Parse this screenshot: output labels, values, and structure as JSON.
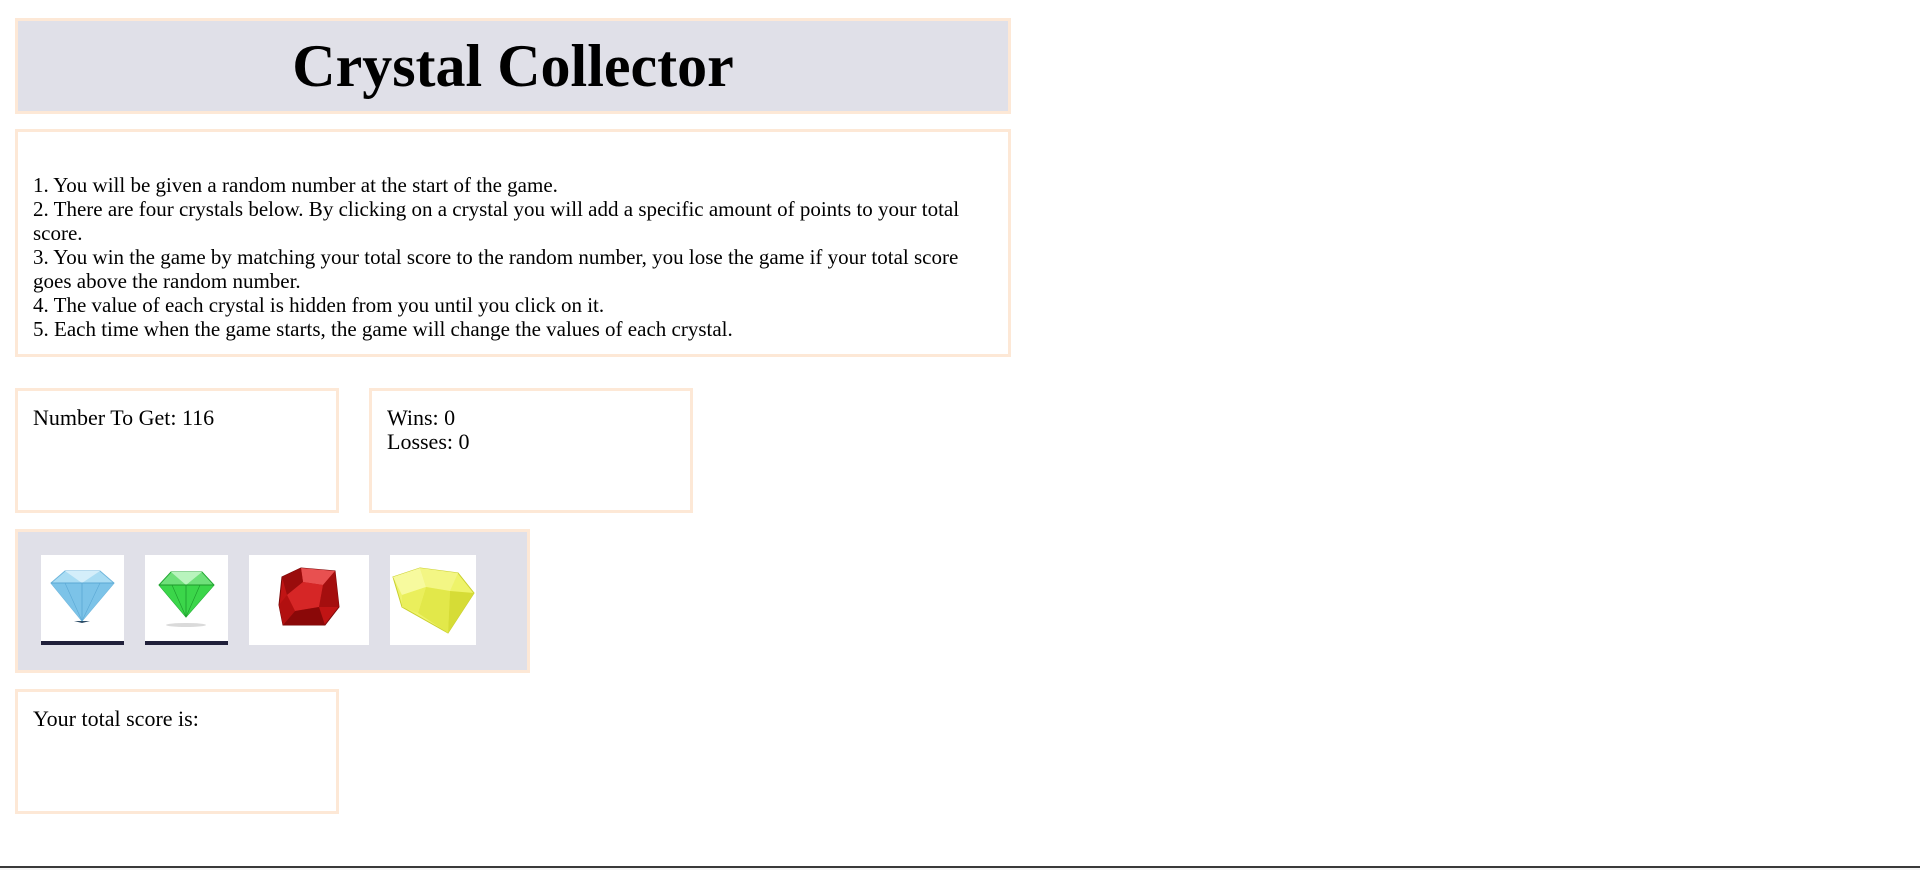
{
  "header": {
    "title": "Crystal Collector"
  },
  "rules": [
    "1. You will be given a random number at the start of the game.",
    "2. There are four crystals below. By clicking on a crystal you will add a specific amount of points to your total score.",
    "3. You win the game by matching your total score to the random number, you lose the game if your total score goes above the random number.",
    "4. The value of each crystal is hidden from you until you click on it.",
    "5. Each time when the game starts, the game will change the values of each crystal."
  ],
  "target": {
    "label": "Number To Get:",
    "value": "116"
  },
  "record": {
    "wins_label": "Wins:",
    "wins": "0",
    "losses_label": "Losses:",
    "losses": "0"
  },
  "crystals": [
    {
      "icon": "blue-diamond-icon",
      "color": "#8fd0f0"
    },
    {
      "icon": "green-emerald-icon",
      "color": "#3bd64a"
    },
    {
      "icon": "red-ruby-icon",
      "color": "#c01414"
    },
    {
      "icon": "yellow-gem-icon",
      "color": "#e8ef4a"
    }
  ],
  "score": {
    "label": "Your total score is:",
    "value": ""
  },
  "colors": {
    "panel_bg": "#e0e0e8",
    "panel_border": "#fde8d6"
  }
}
